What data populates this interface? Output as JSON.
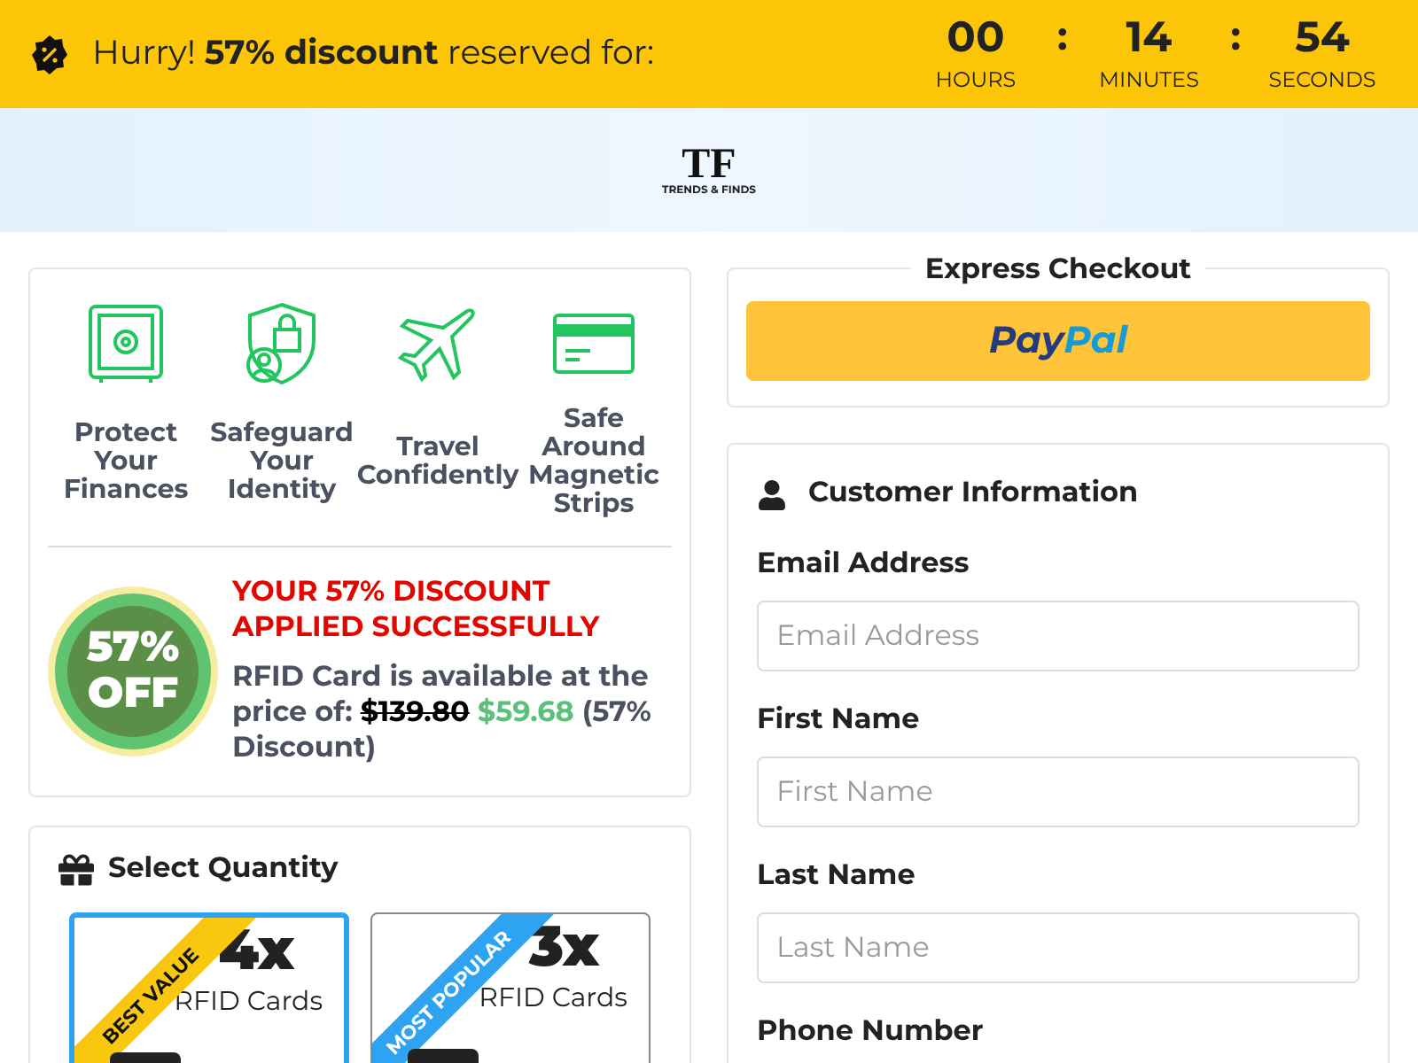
{
  "promo_bar": {
    "message": "Hurry! **57% discount** reserved for:",
    "timer": [
      {
        "value": "00",
        "unit": "HOURS"
      },
      {
        "value": "14",
        "unit": "MINUTES"
      },
      {
        "value": "54",
        "unit": "SECONDS"
      }
    ],
    "separator": ":"
  },
  "logo": {
    "mark": "TF",
    "name": "TRENDS & FINDS"
  },
  "features": [
    {
      "kind": "safe",
      "label": "Protect Your Finances"
    },
    {
      "kind": "shield",
      "label": "Safeguard Your Identity"
    },
    {
      "kind": "plane",
      "label": "Travel Confidently"
    },
    {
      "kind": "card",
      "label": "Safe Around Magnetic Strips"
    }
  ],
  "discount": {
    "badge": [
      "57%",
      "OFF"
    ],
    "headline": "YOUR 57% DISCOUNT APPLIED SUCCESSFULLY",
    "text": "RFID Card is available at the price of:",
    "old_price": "$139.80",
    "new_price": "$59.68",
    "note": "(57% Discount)"
  },
  "quantity": {
    "title": "Select Quantity",
    "options": [
      {
        "ribbon": "BEST VALUE",
        "color": "#f9c80e",
        "count": "4x",
        "label": "RFID Cards",
        "selected": true
      },
      {
        "ribbon": "MOST POPULAR",
        "color": "#2ea3f2",
        "count": "3x",
        "label": "RFID Cards",
        "selected": false
      }
    ]
  },
  "express": {
    "title": "Express Checkout",
    "button_pay": "Pay",
    "button_pal": "Pal"
  },
  "customer": {
    "title": "Customer Information",
    "fields": [
      {
        "label": "Email Address",
        "placeholder": "Email Address",
        "kind": "text"
      },
      {
        "label": "First Name",
        "placeholder": "First Name",
        "kind": "text"
      },
      {
        "label": "Last Name",
        "placeholder": "Last Name",
        "kind": "text"
      },
      {
        "label": "Phone Number",
        "kind": "phone"
      }
    ]
  }
}
